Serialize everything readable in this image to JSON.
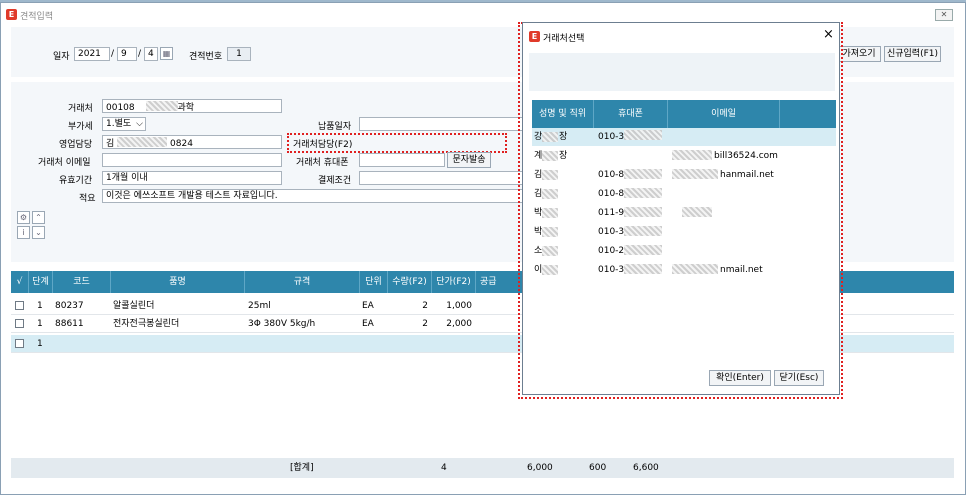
{
  "window": {
    "title": "견적입력",
    "close_glyph": "✕"
  },
  "header": {
    "date_label": "일자",
    "year": "2021",
    "month": "9",
    "day": "4",
    "sep": "/",
    "quote_no_label": "견적번호",
    "quote_no": "1",
    "load_button": "가져오기",
    "new_button": "신규입력(F1)"
  },
  "form": {
    "client_label": "거래처",
    "client_code": "00108",
    "client_name_suffix": "과학",
    "vat_label": "부가세",
    "vat_value": "1.별도",
    "sales_rep_label": "영업담당",
    "sales_rep_prefix": "김",
    "sales_rep_suffix": "0824",
    "contact_label": "거래처담당(F2)",
    "delivery_date_label": "납품일자",
    "client_email_label": "거래처 이메일",
    "client_phone_label": "거래처 휴대폰",
    "sms_button": "문자발송",
    "validity_label": "유효기간",
    "validity_value": "1개월 이내",
    "payment_terms_label": "결제조건",
    "summary_label": "적요",
    "summary_value": "이것은 에쓰소프트 개발용 테스트 자료입니다."
  },
  "grid": {
    "columns": [
      "√",
      "단계",
      "코드",
      "품명",
      "규격",
      "단위",
      "수량(F2)",
      "단가(F2)",
      "공급"
    ],
    "rows": [
      {
        "step": "1",
        "code": "80237",
        "name": "알콜실린더",
        "spec": "25ml",
        "unit": "EA",
        "qty": "2",
        "price": "1,000"
      },
      {
        "step": "1",
        "code": "88611",
        "name": "전자전극봉실린더",
        "spec": "3Φ 380V 5kg/h",
        "unit": "EA",
        "qty": "2",
        "price": "2,000"
      },
      {
        "step": "1",
        "code": "",
        "name": "",
        "spec": "",
        "unit": "",
        "qty": "",
        "price": ""
      }
    ],
    "footer": {
      "label": "[합계]",
      "qty": "4",
      "supply": "6,000",
      "vat": "600",
      "total": "6,600"
    }
  },
  "popup": {
    "title": "거래처선택",
    "close_glyph": "×",
    "columns": [
      "성명 및 직위",
      "휴대폰",
      "이메일"
    ],
    "rows": [
      {
        "name": "강",
        "title": "장",
        "phone": "010-3",
        "email": ""
      },
      {
        "name": "계",
        "title": "장",
        "phone": "",
        "email": "bill36524.com"
      },
      {
        "name": "김",
        "title": "",
        "phone": "010-8",
        "email": "hanmail.net"
      },
      {
        "name": "김",
        "title": "",
        "phone": "010-8",
        "email": ""
      },
      {
        "name": "박",
        "title": "",
        "phone": "011-9",
        "email": ""
      },
      {
        "name": "박",
        "title": "",
        "phone": "010-3",
        "email": ""
      },
      {
        "name": "소",
        "title": "",
        "phone": "010-2",
        "email": ""
      },
      {
        "name": "이",
        "title": "",
        "phone": "010-3",
        "email": "nmail.net"
      }
    ],
    "confirm_button": "확인(Enter)",
    "close_button": "닫기(Esc)"
  },
  "colors": {
    "accent": "#2e86ab",
    "highlight": "#e02020"
  },
  "icons": {
    "app": "app-logo-icon",
    "calendar": "calendar-icon",
    "gear": "gear-icon",
    "info": "info-icon",
    "up": "chevron-up-icon",
    "down": "chevron-down-icon"
  }
}
